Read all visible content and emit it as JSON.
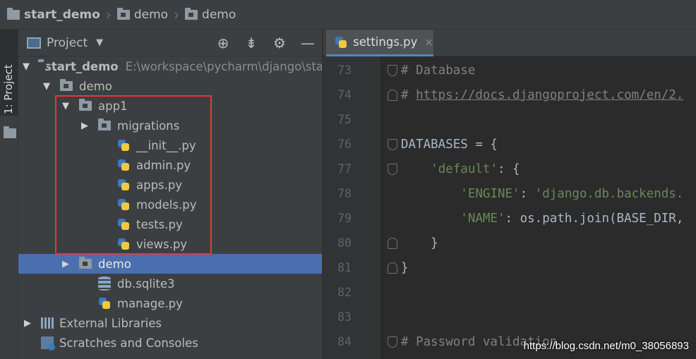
{
  "breadcrumb": [
    "start_demo",
    "demo",
    "demo"
  ],
  "toolwindow": {
    "tab_label": "1: Project"
  },
  "panel": {
    "title": "Project",
    "dropdown_icon": "caret-down-icon"
  },
  "tree": [
    {
      "label": "start_demo",
      "hint": "E:\\workspace\\pycharm\\django\\sta",
      "indent": 0,
      "arrow": "▼",
      "icon": "folder"
    },
    {
      "label": "demo",
      "indent": 1,
      "arrow": "▼",
      "icon": "folder"
    },
    {
      "label": "app1",
      "indent": 2,
      "arrow": "▼",
      "icon": "folder"
    },
    {
      "label": "migrations",
      "indent": 3,
      "arrow": "▶",
      "icon": "folder"
    },
    {
      "label": "__init__.py",
      "indent": 4,
      "arrow": "",
      "icon": "py"
    },
    {
      "label": "admin.py",
      "indent": 4,
      "arrow": "",
      "icon": "py"
    },
    {
      "label": "apps.py",
      "indent": 4,
      "arrow": "",
      "icon": "py"
    },
    {
      "label": "models.py",
      "indent": 4,
      "arrow": "",
      "icon": "py"
    },
    {
      "label": "tests.py",
      "indent": 4,
      "arrow": "",
      "icon": "py"
    },
    {
      "label": "views.py",
      "indent": 4,
      "arrow": "",
      "icon": "py"
    },
    {
      "label": "demo",
      "indent": 2,
      "arrow": "▶",
      "icon": "folder",
      "selected": true
    },
    {
      "label": "db.sqlite3",
      "indent": 3,
      "arrow": "",
      "icon": "db"
    },
    {
      "label": "manage.py",
      "indent": 3,
      "arrow": "",
      "icon": "py"
    },
    {
      "label": "External Libraries",
      "indent": 0,
      "arrow": "▶",
      "icon": "lib"
    },
    {
      "label": "Scratches and Consoles",
      "indent": 0,
      "arrow": "",
      "icon": "scratch"
    }
  ],
  "editor": {
    "tab_label": "settings.py",
    "tab_close": "×",
    "lines": [
      {
        "num": "73",
        "fold": "start",
        "parts": [
          [
            "cmt",
            "# Database"
          ]
        ]
      },
      {
        "num": "74",
        "fold": "end",
        "parts": [
          [
            "cmt",
            "# "
          ],
          [
            "link",
            "https://docs.djangoproject.com/en/2."
          ]
        ]
      },
      {
        "num": "75",
        "fold": "",
        "parts": []
      },
      {
        "num": "76",
        "fold": "start",
        "parts": [
          [
            "plain",
            "DATABASES = {"
          ]
        ]
      },
      {
        "num": "77",
        "fold": "start",
        "parts": [
          [
            "plain",
            "    "
          ],
          [
            "str",
            "'default'"
          ],
          [
            "plain",
            ": {"
          ]
        ]
      },
      {
        "num": "78",
        "fold": "",
        "parts": [
          [
            "plain",
            "        "
          ],
          [
            "str",
            "'ENGINE'"
          ],
          [
            "plain",
            ": "
          ],
          [
            "str",
            "'django.db.backends."
          ]
        ]
      },
      {
        "num": "79",
        "fold": "",
        "parts": [
          [
            "plain",
            "        "
          ],
          [
            "str",
            "'NAME'"
          ],
          [
            "plain",
            ": os.path.join(BASE_DIR,"
          ]
        ]
      },
      {
        "num": "80",
        "fold": "end",
        "parts": [
          [
            "plain",
            "    }"
          ]
        ]
      },
      {
        "num": "81",
        "fold": "end",
        "parts": [
          [
            "plain",
            "}"
          ]
        ]
      },
      {
        "num": "82",
        "fold": "",
        "parts": []
      },
      {
        "num": "83",
        "fold": "",
        "parts": []
      },
      {
        "num": "84",
        "fold": "start",
        "parts": [
          [
            "cmt",
            "# Password validation"
          ]
        ]
      }
    ]
  },
  "watermark": "https://blog.csdn.net/m0_38056893"
}
